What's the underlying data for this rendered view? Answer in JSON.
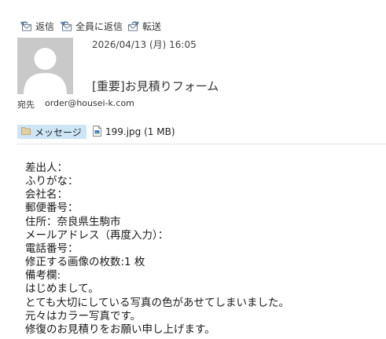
{
  "toolbar": {
    "reply_label": "返信",
    "reply_all_label": "全員に返信",
    "forward_label": "転送"
  },
  "message": {
    "date": "2026/04/13 (月) 16:05",
    "subject": "[重要]お見積りフォーム",
    "to_label": "宛先",
    "to_address": "order@housei-k.com"
  },
  "attachments": {
    "message_tab_label": "メッセージ",
    "file_label": "199.jpg (1 MB)"
  },
  "body": {
    "lines": [
      "差出人：",
      "ふりがな：",
      "会社名：",
      "郵便番号：",
      "住所：奈良県生駒市",
      "メールアドレス（再度入力）：",
      "電話番号：",
      "修正する画像の枚数:1 枚",
      "備考欄:",
      "はじめまして。",
      "とても大切にしている写真の色があせてしまいました。",
      "元々はカラー写真です。",
      "修復のお見積りをお願い申し上げます。"
    ]
  },
  "icons": {
    "reply": "reply-icon",
    "reply_all": "reply-all-icon",
    "forward": "forward-icon",
    "message_tab": "folder-icon",
    "attachment": "image-file-icon"
  },
  "colors": {
    "tab_highlight": "#cde6f7",
    "avatar_bg": "#c9c9c9",
    "icon_accent": "#4a6f9c"
  }
}
